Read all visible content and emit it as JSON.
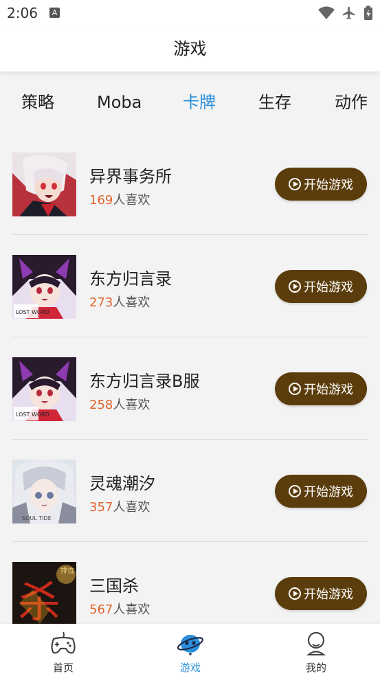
{
  "status": {
    "time": "2:06",
    "a_label": "A"
  },
  "header": {
    "title": "游戏"
  },
  "tabs": [
    {
      "label": "策略",
      "active": false
    },
    {
      "label": "Moba",
      "active": false
    },
    {
      "label": "卡牌",
      "active": true
    },
    {
      "label": "生存",
      "active": false
    },
    {
      "label": "动作",
      "active": false
    }
  ],
  "games": [
    {
      "name": "异界事务所",
      "likes": "169",
      "likes_suffix": "人喜欢",
      "button": "开始游戏"
    },
    {
      "name": "东方归言录",
      "likes": "273",
      "likes_suffix": "人喜欢",
      "button": "开始游戏"
    },
    {
      "name": "东方归言录B服",
      "likes": "258",
      "likes_suffix": "人喜欢",
      "button": "开始游戏"
    },
    {
      "name": "灵魂潮汐",
      "likes": "357",
      "likes_suffix": "人喜欢",
      "button": "开始游戏"
    },
    {
      "name": "三国杀",
      "likes": "567",
      "likes_suffix": "人喜欢",
      "button": "开始游戏"
    }
  ],
  "thumb_text": {
    "lost_word": "LOST WORD",
    "soul_tide": "SOUL TIDE",
    "rank": "排位",
    "sha": "杀"
  },
  "nav": [
    {
      "label": "首页",
      "active": false
    },
    {
      "label": "游戏",
      "active": true
    },
    {
      "label": "我的",
      "active": false
    }
  ],
  "colors": {
    "accent": "#2b8fdc",
    "button_bg": "#5b3d0d",
    "likes_number": "#e2652e",
    "background": "#f3f3f3"
  }
}
